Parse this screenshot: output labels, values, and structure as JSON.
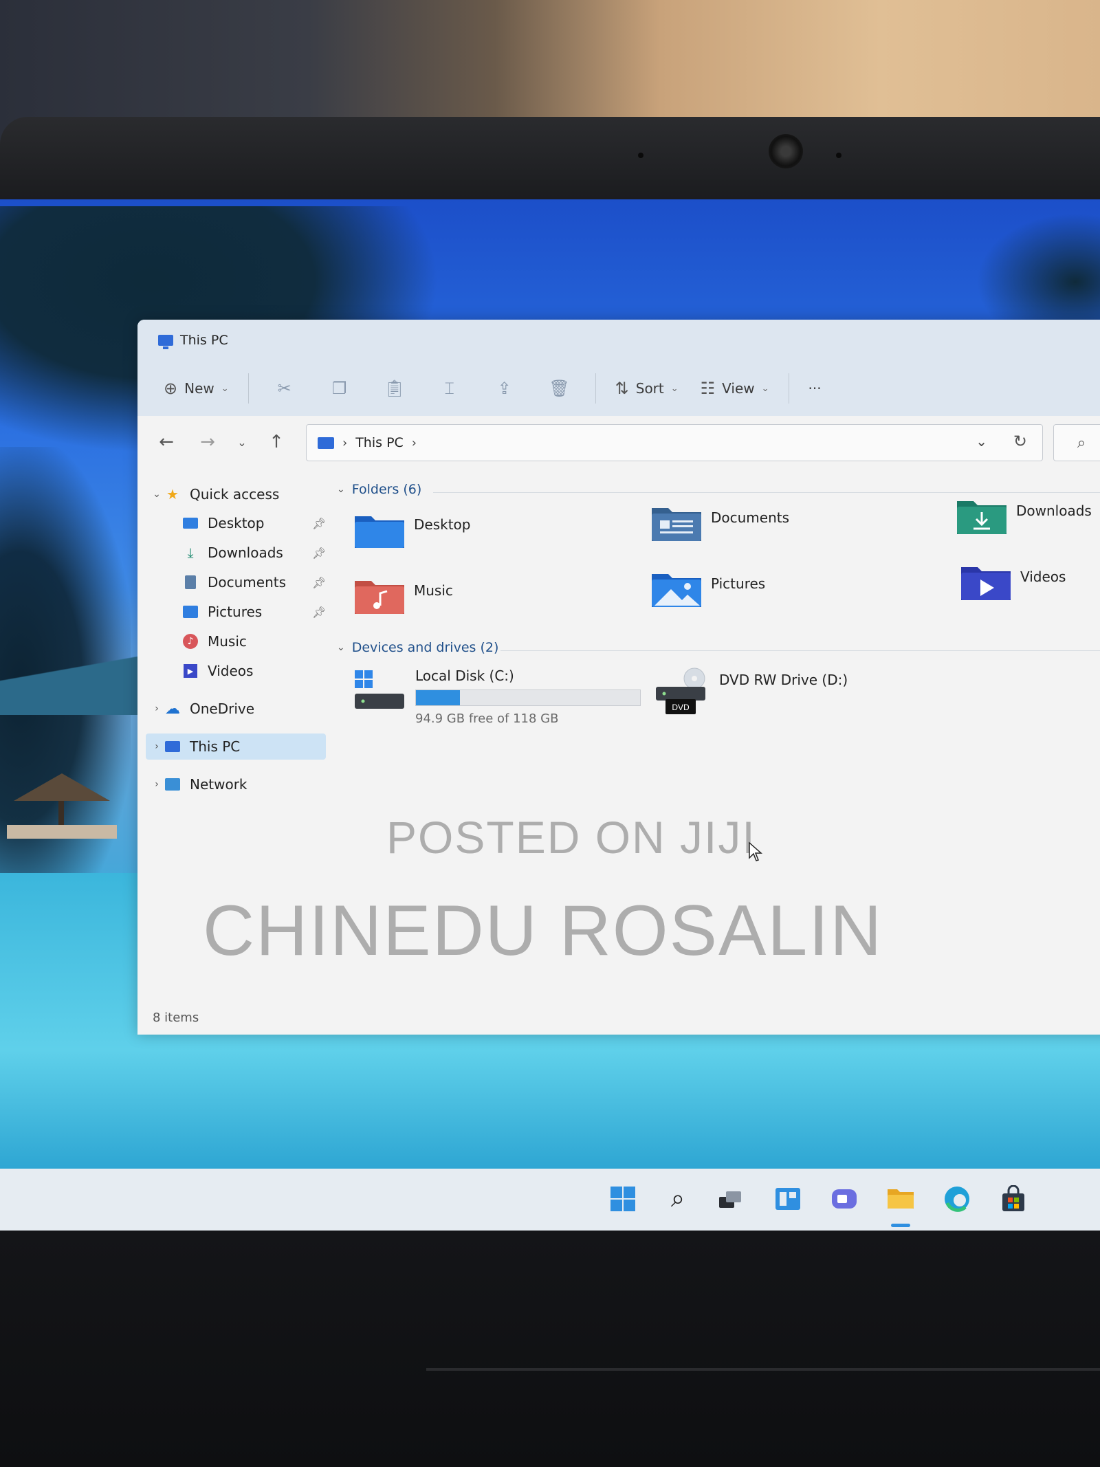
{
  "window": {
    "title": "This PC"
  },
  "toolbar": {
    "new_label": "New",
    "sort_label": "Sort",
    "view_label": "View",
    "more_label": "···",
    "icons": [
      "cut-icon",
      "copy-icon",
      "paste-icon",
      "rename-icon",
      "share-icon",
      "delete-icon"
    ]
  },
  "address": {
    "root_crumb": "This PC",
    "separator": "›"
  },
  "sidebar": {
    "quick_access": "Quick access",
    "items": [
      {
        "label": "Desktop",
        "pinned": true
      },
      {
        "label": "Downloads",
        "pinned": true
      },
      {
        "label": "Documents",
        "pinned": true
      },
      {
        "label": "Pictures",
        "pinned": true
      },
      {
        "label": "Music",
        "pinned": false
      },
      {
        "label": "Videos",
        "pinned": false
      }
    ],
    "onedrive": "OneDrive",
    "thispc": "This PC",
    "network": "Network"
  },
  "content": {
    "folders_header": "Folders (6)",
    "folders": [
      {
        "label": "Desktop"
      },
      {
        "label": "Documents"
      },
      {
        "label": "Downloads"
      },
      {
        "label": "Music"
      },
      {
        "label": "Pictures"
      },
      {
        "label": "Videos"
      }
    ],
    "drives_header": "Devices and drives (2)",
    "drives": [
      {
        "label": "Local Disk (C:)",
        "free": "94.9 GB free of 118 GB",
        "used_fraction": 0.196
      },
      {
        "label": "DVD RW Drive (D:)",
        "badge": "DVD"
      }
    ]
  },
  "status": {
    "items": "8 items"
  },
  "watermark": {
    "line1": "POSTED ON JIJI",
    "line2": "CHINEDU ROSALIN"
  },
  "colors": {
    "accent": "#2f8fe0",
    "selection": "#cde3f5",
    "group_header": "#1f4f8a"
  }
}
